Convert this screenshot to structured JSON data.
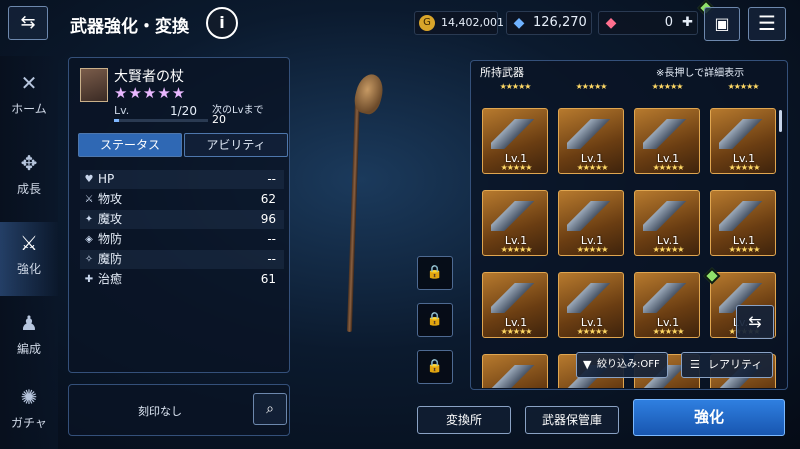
{
  "header": {
    "title": "武器強化・変換",
    "info_label": "i",
    "gil": "14,402,001",
    "crystals": "126,270",
    "paid_crystals": "0",
    "gil_icon": "G"
  },
  "sidenav": [
    {
      "label": "ホーム",
      "icon": "home-icon"
    },
    {
      "label": "成長",
      "icon": "growth-icon"
    },
    {
      "label": "強化",
      "icon": "sword-icon",
      "active": true
    },
    {
      "label": "編成",
      "icon": "party-icon"
    },
    {
      "label": "ガチャ",
      "icon": "gacha-icon"
    }
  ],
  "weapon": {
    "name": "大賢者の杖",
    "stars": "★★★★★",
    "lv_label": "Lv.",
    "lv_value": "1/20",
    "lv_progress": 0.05,
    "next_label": "次のLvまで",
    "next_value": "20"
  },
  "tabs": {
    "status": "ステータス",
    "ability": "アビリティ"
  },
  "stats": [
    {
      "icon": "♥",
      "label": "HP",
      "value": "--"
    },
    {
      "icon": "⚔",
      "label": "物攻",
      "value": "62"
    },
    {
      "icon": "✦",
      "label": "魔攻",
      "value": "96"
    },
    {
      "icon": "◈",
      "label": "物防",
      "value": "--"
    },
    {
      "icon": "✧",
      "label": "魔防",
      "value": "--"
    },
    {
      "icon": "✚",
      "label": "治癒",
      "value": "61"
    }
  ],
  "engrave": {
    "text": "刻印なし"
  },
  "grid": {
    "title": "所持武器",
    "hint": "※長押しで詳細表示",
    "level_label": "Lv.1",
    "stars": "★★★★★"
  },
  "buttons": {
    "filter": "絞り込み:OFF",
    "rarity": "レアリティ",
    "exchange": "変換所",
    "storage": "武器保管庫",
    "enhance": "強化"
  }
}
